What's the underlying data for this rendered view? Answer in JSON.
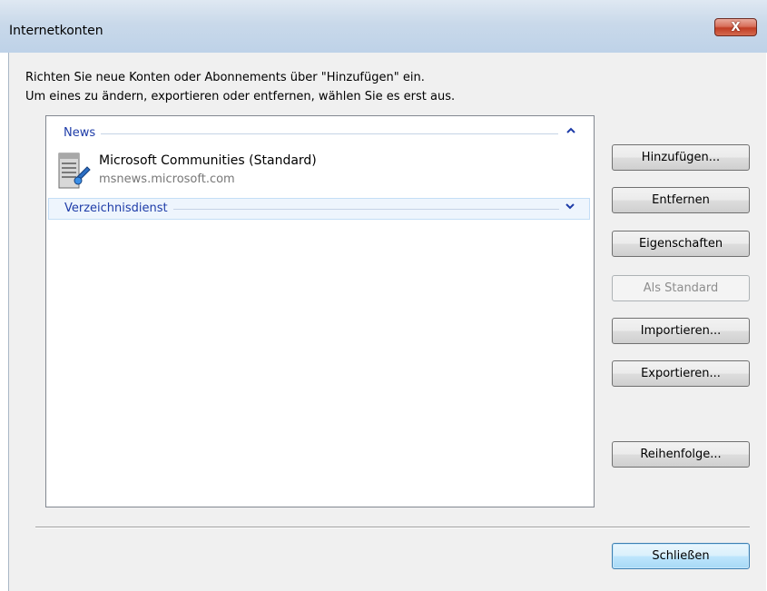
{
  "window": {
    "title": "Internetkonten",
    "close_glyph": "X"
  },
  "instructions": {
    "line1": "Richten Sie neue Konten oder Abonnements über \"Hinzufügen\" ein.",
    "line2": "Um eines zu ändern, exportieren oder entfernen, wählen Sie es erst aus."
  },
  "account_list": {
    "groups": [
      {
        "label": "News",
        "expanded": true,
        "chevron": "^",
        "chevron_icon": "chevron-up-icon",
        "items": [
          {
            "name": "Microsoft Communities (Standard)",
            "server": "msnews.microsoft.com",
            "icon": "news-server-icon"
          }
        ]
      },
      {
        "label": "Verzeichnisdienst",
        "expanded": false,
        "selected": true,
        "chevron": "v",
        "chevron_icon": "chevron-down-icon"
      }
    ]
  },
  "buttons": {
    "add": "Hinzufügen...",
    "remove": "Entfernen",
    "properties": "Eigenschaften",
    "set_default": "Als Standard",
    "set_default_enabled": false,
    "import": "Importieren...",
    "export": "Exportieren...",
    "order": "Reihenfolge...",
    "close": "Schließen"
  },
  "colors": {
    "group_header_text": "#1e3ca8",
    "close_button": "#c13d24",
    "default_button_border": "#3c7fb1"
  }
}
